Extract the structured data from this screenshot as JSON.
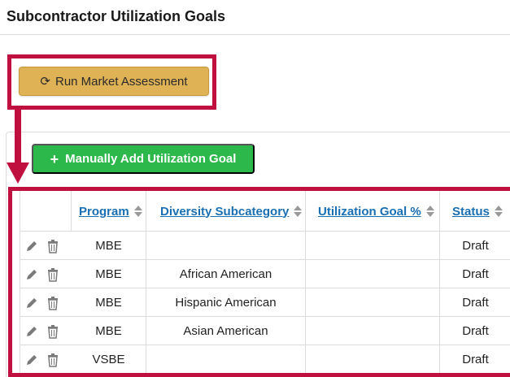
{
  "page": {
    "title": "Subcontractor Utilization Goals"
  },
  "toolbar": {
    "run_assessment_label": "Run Market Assessment",
    "run_assessment_icon": "refresh-icon",
    "add_goal_label": "Manually Add Utilization Goal",
    "add_goal_icon": "plus-icon"
  },
  "table": {
    "columns": [
      {
        "label": "Program",
        "sortable": true
      },
      {
        "label": "Diversity Subcategory",
        "sortable": true
      },
      {
        "label": "Utilization Goal %",
        "sortable": true
      },
      {
        "label": "Status",
        "sortable": true
      }
    ],
    "rows": [
      {
        "program": "MBE",
        "subcategory": "",
        "goal": "",
        "status": "Draft"
      },
      {
        "program": "MBE",
        "subcategory": "African American",
        "goal": "",
        "status": "Draft"
      },
      {
        "program": "MBE",
        "subcategory": "Hispanic American",
        "goal": "",
        "status": "Draft"
      },
      {
        "program": "MBE",
        "subcategory": "Asian American",
        "goal": "",
        "status": "Draft"
      },
      {
        "program": "VSBE",
        "subcategory": "",
        "goal": "",
        "status": "Draft"
      }
    ],
    "row_action_icons": [
      "pencil-icon",
      "trash-icon"
    ]
  },
  "colors": {
    "annotation": "#c0103f",
    "run_button": "#dfb255",
    "add_button": "#2db84b",
    "link": "#1a6fb3"
  }
}
